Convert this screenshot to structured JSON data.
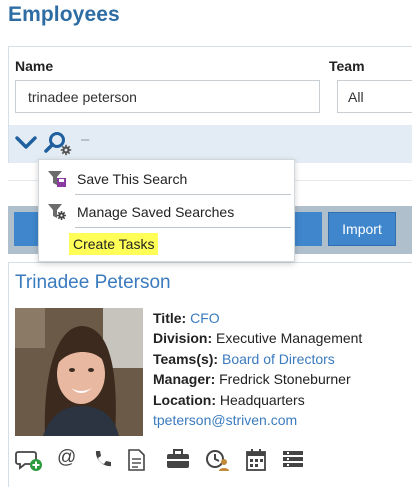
{
  "page_title": "Employees",
  "filters": {
    "name_label": "Name",
    "team_label": "Team",
    "name_value": "trinadee peterson",
    "team_value": "All"
  },
  "search_bar": {
    "dash": "–"
  },
  "dropdown": {
    "items": [
      {
        "label": "Save This Search",
        "icon": "save-search-icon"
      },
      {
        "label": "Manage Saved Searches",
        "icon": "manage-searches-icon"
      },
      {
        "label": "Create Tasks",
        "icon": "none"
      }
    ]
  },
  "actions": {
    "import_label": "Import"
  },
  "employee": {
    "name": "Trinadee Peterson",
    "title_label": "Title:",
    "title_value": "CFO",
    "division_label": "Division:",
    "division_value": "Executive Management",
    "teams_label": "Teams(s):",
    "teams_value": "Board of Directors",
    "manager_label": "Manager:",
    "manager_value": "Fredrick Stoneburner",
    "location_label": "Location:",
    "location_value": "Headquarters",
    "email": "tpeterson@striven.com"
  },
  "icons": [
    "add-chat-icon",
    "email-icon",
    "phone-icon",
    "document-icon",
    "briefcase-icon",
    "time-user-icon",
    "calendar-icon",
    "list-icon"
  ],
  "colors": {
    "accent": "#2e6da4",
    "link": "#3a7bbf",
    "button": "#3f86cc",
    "highlight": "#ffff57",
    "search_bar_bg": "#e3ecf4"
  }
}
